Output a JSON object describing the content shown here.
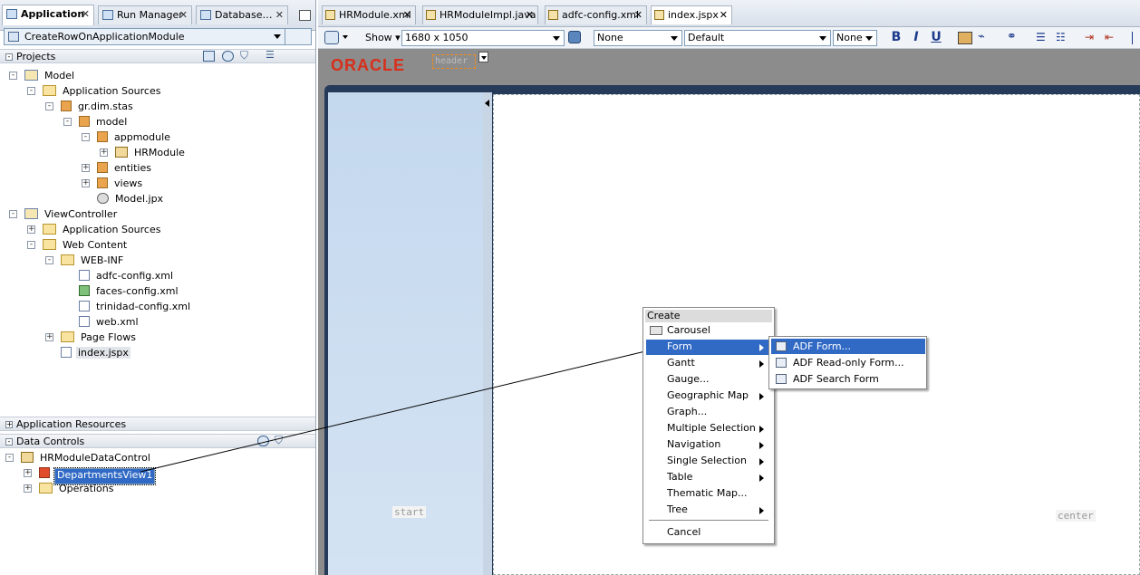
{
  "left_tabs": [
    {
      "label": "Application",
      "close": "✕"
    },
    {
      "label": "Run Manager",
      "close": "✕"
    },
    {
      "label": "Database…",
      "close": "✕"
    }
  ],
  "app_selector": {
    "value": "CreateRowOnApplicationModule"
  },
  "sections": {
    "projects": "Projects",
    "app_resources": "Application Resources",
    "data_controls": "Data Controls"
  },
  "tree": {
    "model": "Model",
    "app_sources": "Application Sources",
    "gr_dim_stas": "gr.dim.stas",
    "model_pkg": "model",
    "appmodule": "appmodule",
    "hrmodule": "HRModule",
    "entities": "entities",
    "views": "views",
    "model_jpx": "Model.jpx",
    "viewcontroller": "ViewController",
    "vc_app_sources": "Application Sources",
    "web_content": "Web Content",
    "web_inf": "WEB-INF",
    "adfc_config": "adfc-config.xml",
    "faces_config": "faces-config.xml",
    "trinidad_config": "trinidad-config.xml",
    "web_xml": "web.xml",
    "page_flows": "Page Flows",
    "index_jspx": "index.jspx"
  },
  "data_controls_tree": {
    "root": "HRModuleDataControl",
    "departments": "DepartmentsView1",
    "operations": "Operations"
  },
  "editor_tabs": [
    {
      "label": "HRModule.xml",
      "close": "✕"
    },
    {
      "label": "HRModuleImpl.java",
      "close": "✕"
    },
    {
      "label": "adfc-config.xml",
      "close": "✕"
    },
    {
      "label": "index.jspx",
      "close": "✕"
    }
  ],
  "toolbar": {
    "show_label": "Show",
    "resolution": "1680 x 1050",
    "style_class": "None",
    "font": "Default",
    "size": "None",
    "bold": "B",
    "italic": "I",
    "underline": "U"
  },
  "canvas": {
    "brand": "ORACLE",
    "header_facet": "header",
    "start_facet": "start",
    "center_facet": "center"
  },
  "context_menu": {
    "title": "Create",
    "items": [
      "Carousel",
      "Form",
      "Gantt",
      "Gauge...",
      "Geographic Map",
      "Graph...",
      "Multiple Selection",
      "Navigation",
      "Single Selection",
      "Table",
      "Thematic Map...",
      "Tree",
      "Cancel"
    ]
  },
  "submenu": {
    "items": [
      "ADF Form...",
      "ADF Read-only Form...",
      "ADF Search Form"
    ]
  },
  "colors": {
    "selection": "#316ac5",
    "oracle_red": "#d82f1b",
    "canvas_gray": "#8c8c8c"
  }
}
